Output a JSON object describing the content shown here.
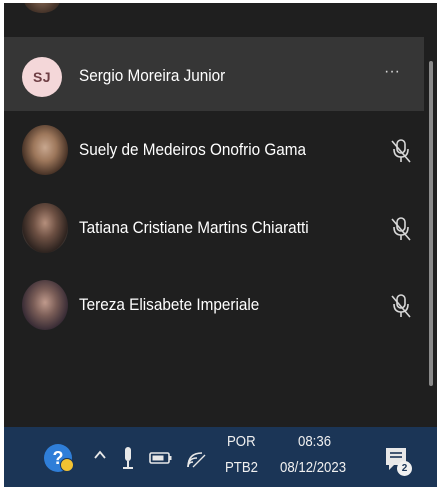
{
  "self_participant": {
    "initials": "SJ",
    "name": "Sergio Moreira Junior",
    "more_label": "···"
  },
  "participants": [
    {
      "name": "Suely de Medeiros Onofrio Gama",
      "mic": "muted"
    },
    {
      "name": "Tatiana Cristiane Martins Chiaratti",
      "mic": "muted"
    },
    {
      "name": "Tereza Elisabete Imperiale",
      "mic": "muted"
    }
  ],
  "taskbar": {
    "help_glyph": "?",
    "language": "POR",
    "keyboard": "PTB2",
    "time": "08:36",
    "date": "08/12/2023",
    "notification_count": "2"
  },
  "icons": {
    "participant_mic": "mic-off-icon",
    "tray": [
      "help-icon",
      "chevron-up-icon",
      "microphone-icon",
      "battery-icon",
      "wifi-icon",
      "notification-icon"
    ]
  },
  "colors": {
    "panel_bg": "#1f1f1f",
    "selected_row_bg": "#363636",
    "initials_avatar_bg": "#f4d7d9",
    "taskbar_bg": "#1b3556"
  }
}
